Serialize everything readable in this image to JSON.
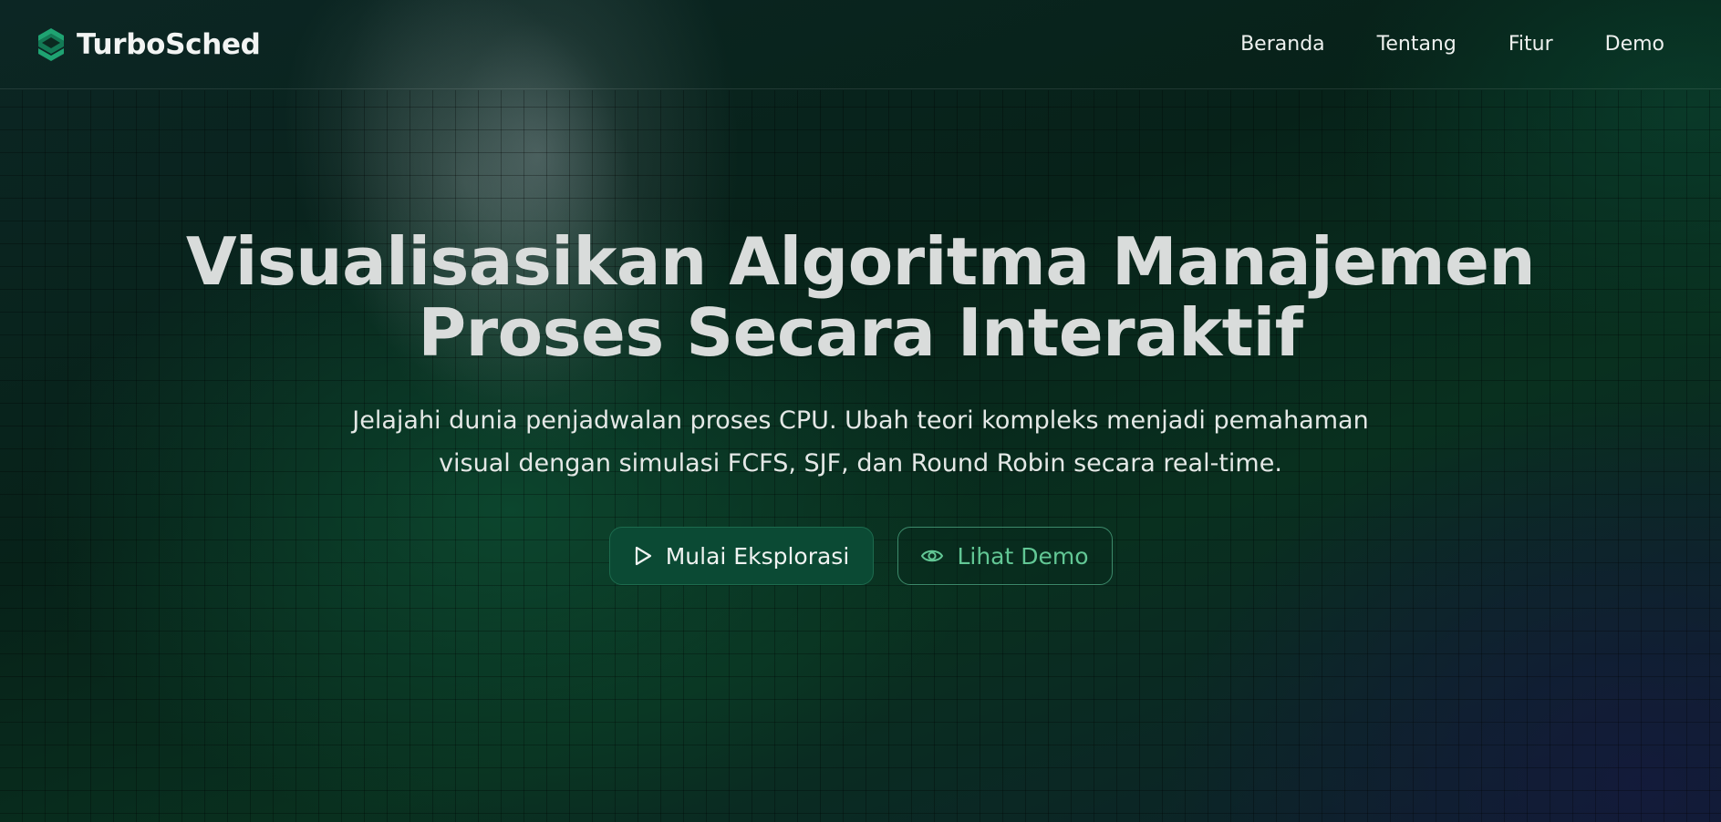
{
  "brand": {
    "name": "TurboSched",
    "logo_icon": "s-hexagon-logo-icon",
    "logo_color": "#1fa372"
  },
  "nav": {
    "items": [
      {
        "label": "Beranda"
      },
      {
        "label": "Tentang"
      },
      {
        "label": "Fitur"
      },
      {
        "label": "Demo"
      }
    ]
  },
  "hero": {
    "title_line1": "Visualisasikan Algoritma Manajemen",
    "title_line2": "Proses Secara Interaktif",
    "subtitle_line1": "Jelajahi dunia penjadwalan proses CPU. Ubah teori kompleks menjadi pemahaman",
    "subtitle_line2": "visual dengan simulasi FCFS, SJF, dan Round Robin secara real-time."
  },
  "actions": {
    "primary_label": "Mulai Eksplorasi",
    "primary_icon": "play-icon",
    "secondary_label": "Lihat Demo",
    "secondary_icon": "eye-icon"
  },
  "colors": {
    "accent_green": "#62c795",
    "primary_button_bg": "#0b4a34",
    "background_dark": "#0b1f1a"
  }
}
